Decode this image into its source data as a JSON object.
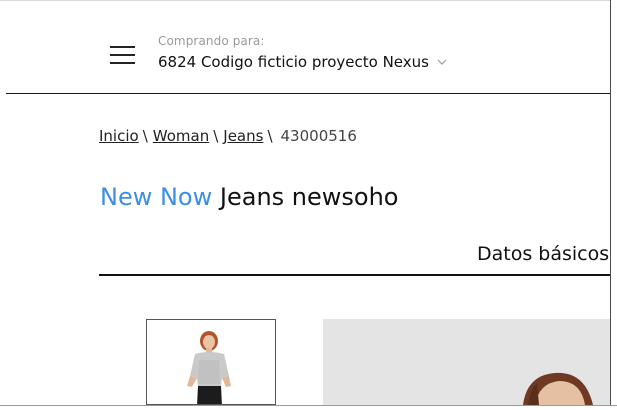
{
  "header": {
    "shopping_for_label": "Comprando para:",
    "shopping_for_value": "6824 Codigo ficticio proyecto Nexus"
  },
  "breadcrumb": {
    "items": [
      "Inicio",
      "Woman",
      "Jeans"
    ],
    "separator": "\\",
    "current": "43000516"
  },
  "product": {
    "collection": "New Now",
    "name": "Jeans newsoho"
  },
  "tabs": {
    "active_label": "Datos básicos"
  },
  "colors": {
    "accent": "#3d8ee6",
    "text": "#111111",
    "muted": "#9a9a9a",
    "image_background": "#e4e4e4"
  },
  "icons": {
    "menu": "hamburger-menu-icon",
    "dropdown": "chevron-down-icon"
  }
}
